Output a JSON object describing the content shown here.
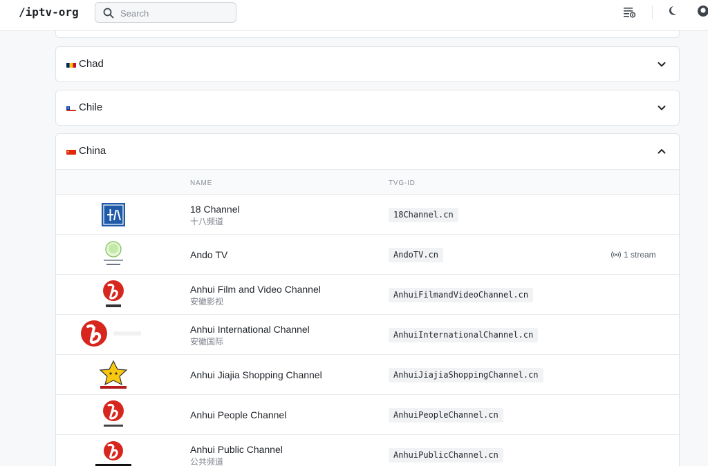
{
  "header": {
    "logo": "/iptv-org",
    "search_placeholder": "Search"
  },
  "countries": [
    {
      "name": "Chad",
      "expanded": false
    },
    {
      "name": "Chile",
      "expanded": false
    },
    {
      "name": "China",
      "expanded": true
    }
  ],
  "table": {
    "columns": [
      "NAME",
      "TVG-ID"
    ],
    "rows": [
      {
        "name": "18 Channel",
        "alt": "十八频道",
        "tvg_id": "18Channel.cn",
        "logo_icon": "18-channel-logo"
      },
      {
        "name": "Ando TV",
        "alt": "",
        "tvg_id": "AndoTV.cn",
        "streams": "1 stream",
        "logo_icon": "ando-tv-logo"
      },
      {
        "name": "Anhui Film and Video Channel",
        "alt": "安徽影视",
        "tvg_id": "AnhuiFilmandVideoChannel.cn",
        "logo_icon": "anhui-film-logo"
      },
      {
        "name": "Anhui International Channel",
        "alt": "安徽国际",
        "tvg_id": "AnhuiInternationalChannel.cn",
        "logo_icon": "anhui-international-logo"
      },
      {
        "name": "Anhui Jiajia Shopping Channel",
        "alt": "",
        "tvg_id": "AnhuiJiajiaShoppingChannel.cn",
        "logo_icon": "jiajia-shopping-logo"
      },
      {
        "name": "Anhui People Channel",
        "alt": "",
        "tvg_id": "AnhuiPeopleChannel.cn",
        "logo_icon": "anhui-people-logo"
      },
      {
        "name": "Anhui Public Channel",
        "alt": "公共频道",
        "tvg_id": "AnhuiPublicChannel.cn",
        "logo_icon": "anhui-public-logo"
      }
    ]
  },
  "colors": {
    "anhui_red": "#d7261e",
    "blue_logo": "#1e5aa8",
    "accent_text": "#1f2328"
  }
}
